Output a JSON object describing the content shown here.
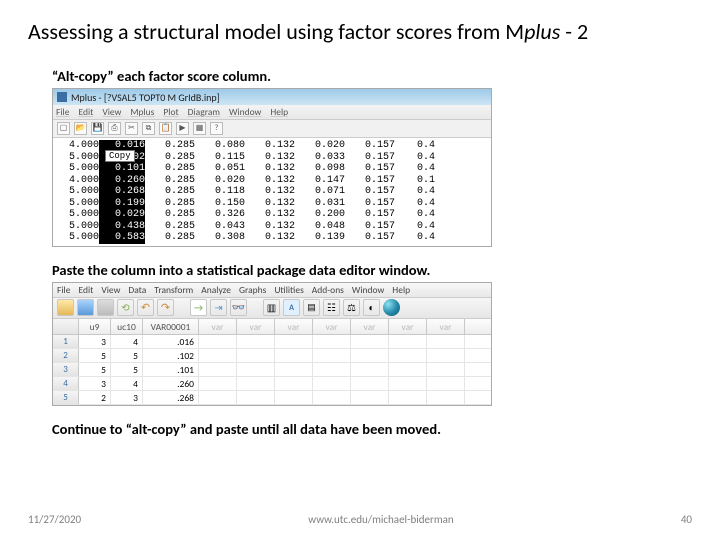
{
  "title_prefix": "Assessing a structural model using factor scores from M",
  "title_italic": "plus",
  "title_suffix": " - 2",
  "step1": "“Alt-copy” each factor score column.",
  "step2": "Paste the column into a statistical package data editor window.",
  "step3": "Continue to “alt-copy” and paste until all data have been moved.",
  "footer": {
    "date": "11/27/2020",
    "url": "www.utc.edu/michael-biderman",
    "page": "40"
  },
  "mplus": {
    "title": "Mplus - [?VSAL5 TOPT0 M GrIdB.inp]",
    "menu": [
      "File",
      "Edit",
      "View",
      "Mplus",
      "Plot",
      "Diagram",
      "Window",
      "Help"
    ],
    "copy_label": "Copy",
    "rows": [
      {
        "c1": "4.000",
        "c2": "0.016",
        "c3": "0.285",
        "c4": "0.080",
        "c5": "0.132",
        "c6": "0.020",
        "c7": "0.157",
        "c8": "0.4"
      },
      {
        "c1": "5.000",
        "c2": "0.102",
        "c3": "0.285",
        "c4": "0.115",
        "c5": "0.132",
        "c6": "0.033",
        "c7": "0.157",
        "c8": "0.4"
      },
      {
        "c1": "5.000",
        "c2": "0.101",
        "c3": "0.285",
        "c4": "0.051",
        "c5": "0.132",
        "c6": "0.098",
        "c7": "0.157",
        "c8": "0.4"
      },
      {
        "c1": "4.000",
        "c2": "0.260",
        "c3": "0.285",
        "c4": "0.020",
        "c5": "0.132",
        "c6": "0.147",
        "c7": "0.157",
        "c8": "0.1"
      },
      {
        "c1": "5.000",
        "c2": "0.268",
        "c3": "0.285",
        "c4": "0.118",
        "c5": "0.132",
        "c6": "0.071",
        "c7": "0.157",
        "c8": "0.4"
      },
      {
        "c1": "5.000",
        "c2": "0.199",
        "c3": "0.285",
        "c4": "0.150",
        "c5": "0.132",
        "c6": "0.031",
        "c7": "0.157",
        "c8": "0.4"
      },
      {
        "c1": "5.000",
        "c2": "0.029",
        "c3": "0.285",
        "c4": "0.326",
        "c5": "0.132",
        "c6": "0.200",
        "c7": "0.157",
        "c8": "0.4"
      },
      {
        "c1": "5.000",
        "c2": "0.438",
        "c3": "0.285",
        "c4": "0.043",
        "c5": "0.132",
        "c6": "0.048",
        "c7": "0.157",
        "c8": "0.4"
      },
      {
        "c1": "5.000",
        "c2": "0.583",
        "c3": "0.285",
        "c4": "0.308",
        "c5": "0.132",
        "c6": "0.139",
        "c7": "0.157",
        "c8": "0.4"
      }
    ]
  },
  "spss": {
    "menu": [
      "File",
      "Edit",
      "View",
      "Data",
      "Transform",
      "Analyze",
      "Graphs",
      "Utilities",
      "Add-ons",
      "Window",
      "Help"
    ],
    "headers": {
      "h1": "u9",
      "h2": "uc10",
      "h3": "VAR00001",
      "v": "var"
    },
    "rows": [
      {
        "n": "1",
        "a": "3",
        "b": "4",
        "c": ".016"
      },
      {
        "n": "2",
        "a": "5",
        "b": "5",
        "c": ".102"
      },
      {
        "n": "3",
        "a": "5",
        "b": "5",
        "c": ".101"
      },
      {
        "n": "4",
        "a": "3",
        "b": "4",
        "c": ".260"
      },
      {
        "n": "5",
        "a": "2",
        "b": "3",
        "c": ".268"
      }
    ]
  }
}
